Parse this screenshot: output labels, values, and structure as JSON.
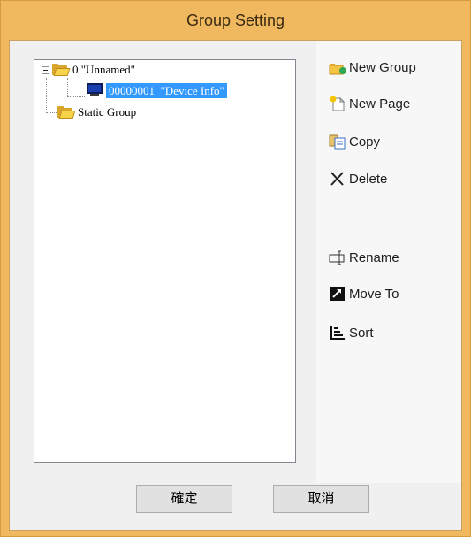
{
  "window": {
    "title": "Group Setting"
  },
  "tree": {
    "group0": {
      "label": "0 \"Unnamed\""
    },
    "device": {
      "id": "00000001",
      "label": "\"Device Info\""
    },
    "static_group": {
      "label": "Static Group"
    }
  },
  "actions": {
    "new_group": "New Group",
    "new_page": "New Page",
    "copy": "Copy",
    "delete": "Delete",
    "rename": "Rename",
    "move_to": "Move To",
    "sort": "Sort"
  },
  "buttons": {
    "ok": "確定",
    "cancel": "取消"
  },
  "colors": {
    "titlebar": "#f0b95f",
    "selection": "#3399ff"
  }
}
